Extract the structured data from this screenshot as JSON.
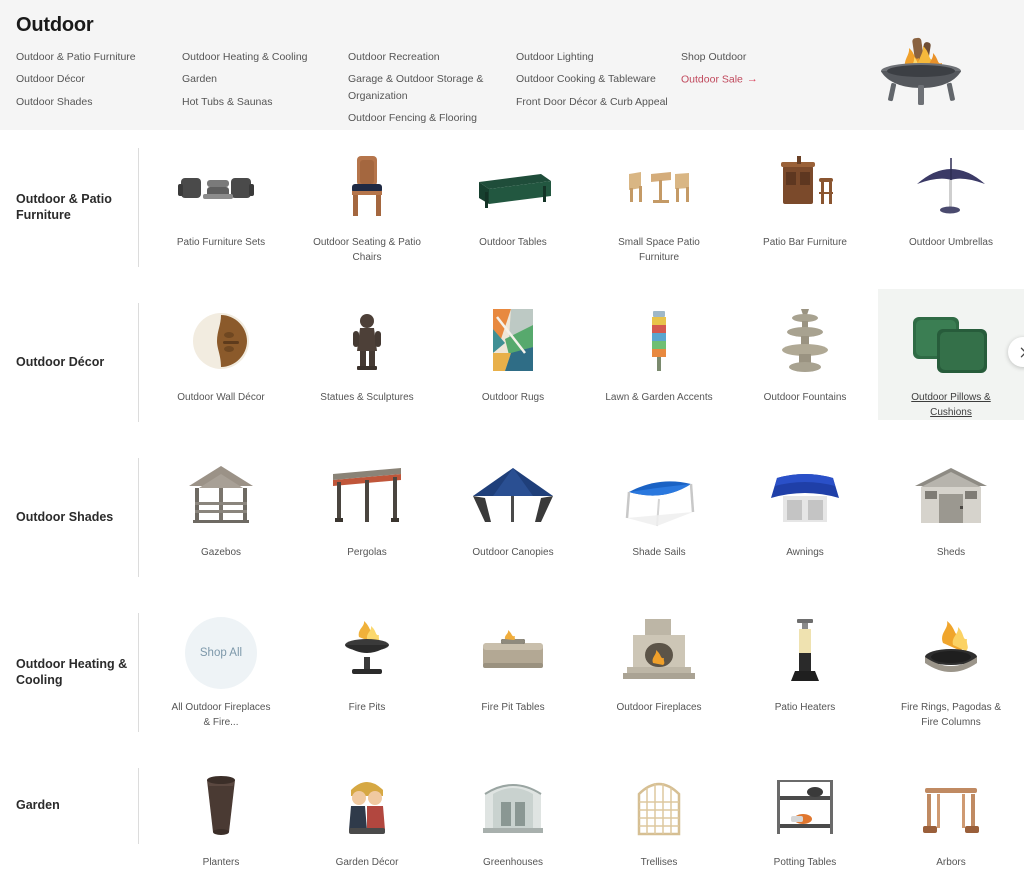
{
  "header": {
    "title": "Outdoor",
    "hero_icon": "fire-pit-image",
    "columns": [
      {
        "links": [
          {
            "label": "Outdoor & Patio Furniture",
            "style": "normal"
          },
          {
            "label": "Outdoor Décor",
            "style": "normal"
          },
          {
            "label": "Outdoor Shades",
            "style": "normal"
          }
        ]
      },
      {
        "links": [
          {
            "label": "Outdoor Heating & Cooling",
            "style": "normal"
          },
          {
            "label": "Garden",
            "style": "normal"
          },
          {
            "label": "Hot Tubs & Saunas",
            "style": "normal"
          }
        ]
      },
      {
        "links": [
          {
            "label": "Outdoor Recreation",
            "style": "normal"
          },
          {
            "label": "Garage & Outdoor Storage & Organization",
            "style": "normal"
          },
          {
            "label": "Outdoor Fencing & Flooring",
            "style": "normal"
          }
        ]
      },
      {
        "links": [
          {
            "label": "Outdoor Lighting",
            "style": "normal"
          },
          {
            "label": "Outdoor Cooking & Tableware",
            "style": "normal"
          },
          {
            "label": "Front Door Décor & Curb Appeal",
            "style": "normal"
          }
        ]
      },
      {
        "links": [
          {
            "label": "Shop Outdoor",
            "style": "normal"
          },
          {
            "label": "Outdoor Sale",
            "style": "sale",
            "arrow": "→"
          }
        ]
      }
    ]
  },
  "colors": {
    "header_bg": "#f5f5f5",
    "sale_red": "#c0485c",
    "active_tile_bg": "#f2f4f2",
    "divider": "#dcdcdc",
    "shopall_bg": "#eef3f6",
    "shopall_text": "#7d98aa"
  },
  "next_button": {
    "icon": "chevron-right-icon"
  },
  "rows": [
    {
      "label": "Outdoor & Patio Furniture",
      "items": [
        {
          "label": "Patio Furniture Sets",
          "art": "patio-set",
          "active": false
        },
        {
          "label": "Outdoor Seating & Patio Chairs",
          "art": "chair",
          "active": false
        },
        {
          "label": "Outdoor Tables",
          "art": "table",
          "active": false
        },
        {
          "label": "Small Space Patio Furniture",
          "art": "bistro-set",
          "active": false
        },
        {
          "label": "Patio Bar Furniture",
          "art": "bar",
          "active": false
        },
        {
          "label": "Outdoor Umbrellas",
          "art": "umbrella",
          "active": false
        }
      ]
    },
    {
      "label": "Outdoor Décor",
      "items": [
        {
          "label": "Outdoor Wall Décor",
          "art": "wall-decor",
          "active": false
        },
        {
          "label": "Statues & Sculptures",
          "art": "statue",
          "active": false
        },
        {
          "label": "Outdoor Rugs",
          "art": "rug",
          "active": false
        },
        {
          "label": "Lawn & Garden Accents",
          "art": "garden-accent",
          "active": false
        },
        {
          "label": "Outdoor Fountains",
          "art": "fountain",
          "active": false
        },
        {
          "label": "Outdoor Pillows & Cushions",
          "art": "pillows",
          "active": true
        }
      ]
    },
    {
      "label": "Outdoor Shades",
      "items": [
        {
          "label": "Gazebos",
          "art": "gazebo",
          "active": false
        },
        {
          "label": "Pergolas",
          "art": "pergola",
          "active": false
        },
        {
          "label": "Outdoor Canopies",
          "art": "canopy",
          "active": false
        },
        {
          "label": "Shade Sails",
          "art": "shade-sail",
          "active": false
        },
        {
          "label": "Awnings",
          "art": "awning",
          "active": false
        },
        {
          "label": "Sheds",
          "art": "shed",
          "active": false
        }
      ]
    },
    {
      "label": "Outdoor Heating & Cooling",
      "items": [
        {
          "label": "All Outdoor Fireplaces & Fire...",
          "art": "shop-all",
          "shop_all_label": "Shop All",
          "active": false
        },
        {
          "label": "Fire Pits",
          "art": "fire-pit",
          "active": false
        },
        {
          "label": "Fire Pit Tables",
          "art": "fire-pit-table",
          "active": false
        },
        {
          "label": "Outdoor Fireplaces",
          "art": "fireplace",
          "active": false
        },
        {
          "label": "Patio Heaters",
          "art": "patio-heater",
          "active": false
        },
        {
          "label": "Fire Rings, Pagodas & Fire Columns",
          "art": "fire-ring",
          "active": false
        }
      ]
    },
    {
      "label": "Garden",
      "items": [
        {
          "label": "Planters",
          "art": "planter",
          "active": false
        },
        {
          "label": "Garden Décor",
          "art": "garden-figurine",
          "active": false
        },
        {
          "label": "Greenhouses",
          "art": "greenhouse",
          "active": false
        },
        {
          "label": "Trellises",
          "art": "trellis",
          "active": false
        },
        {
          "label": "Potting Tables",
          "art": "potting-table",
          "active": false
        },
        {
          "label": "Arbors",
          "art": "arbor",
          "active": false
        }
      ]
    }
  ]
}
